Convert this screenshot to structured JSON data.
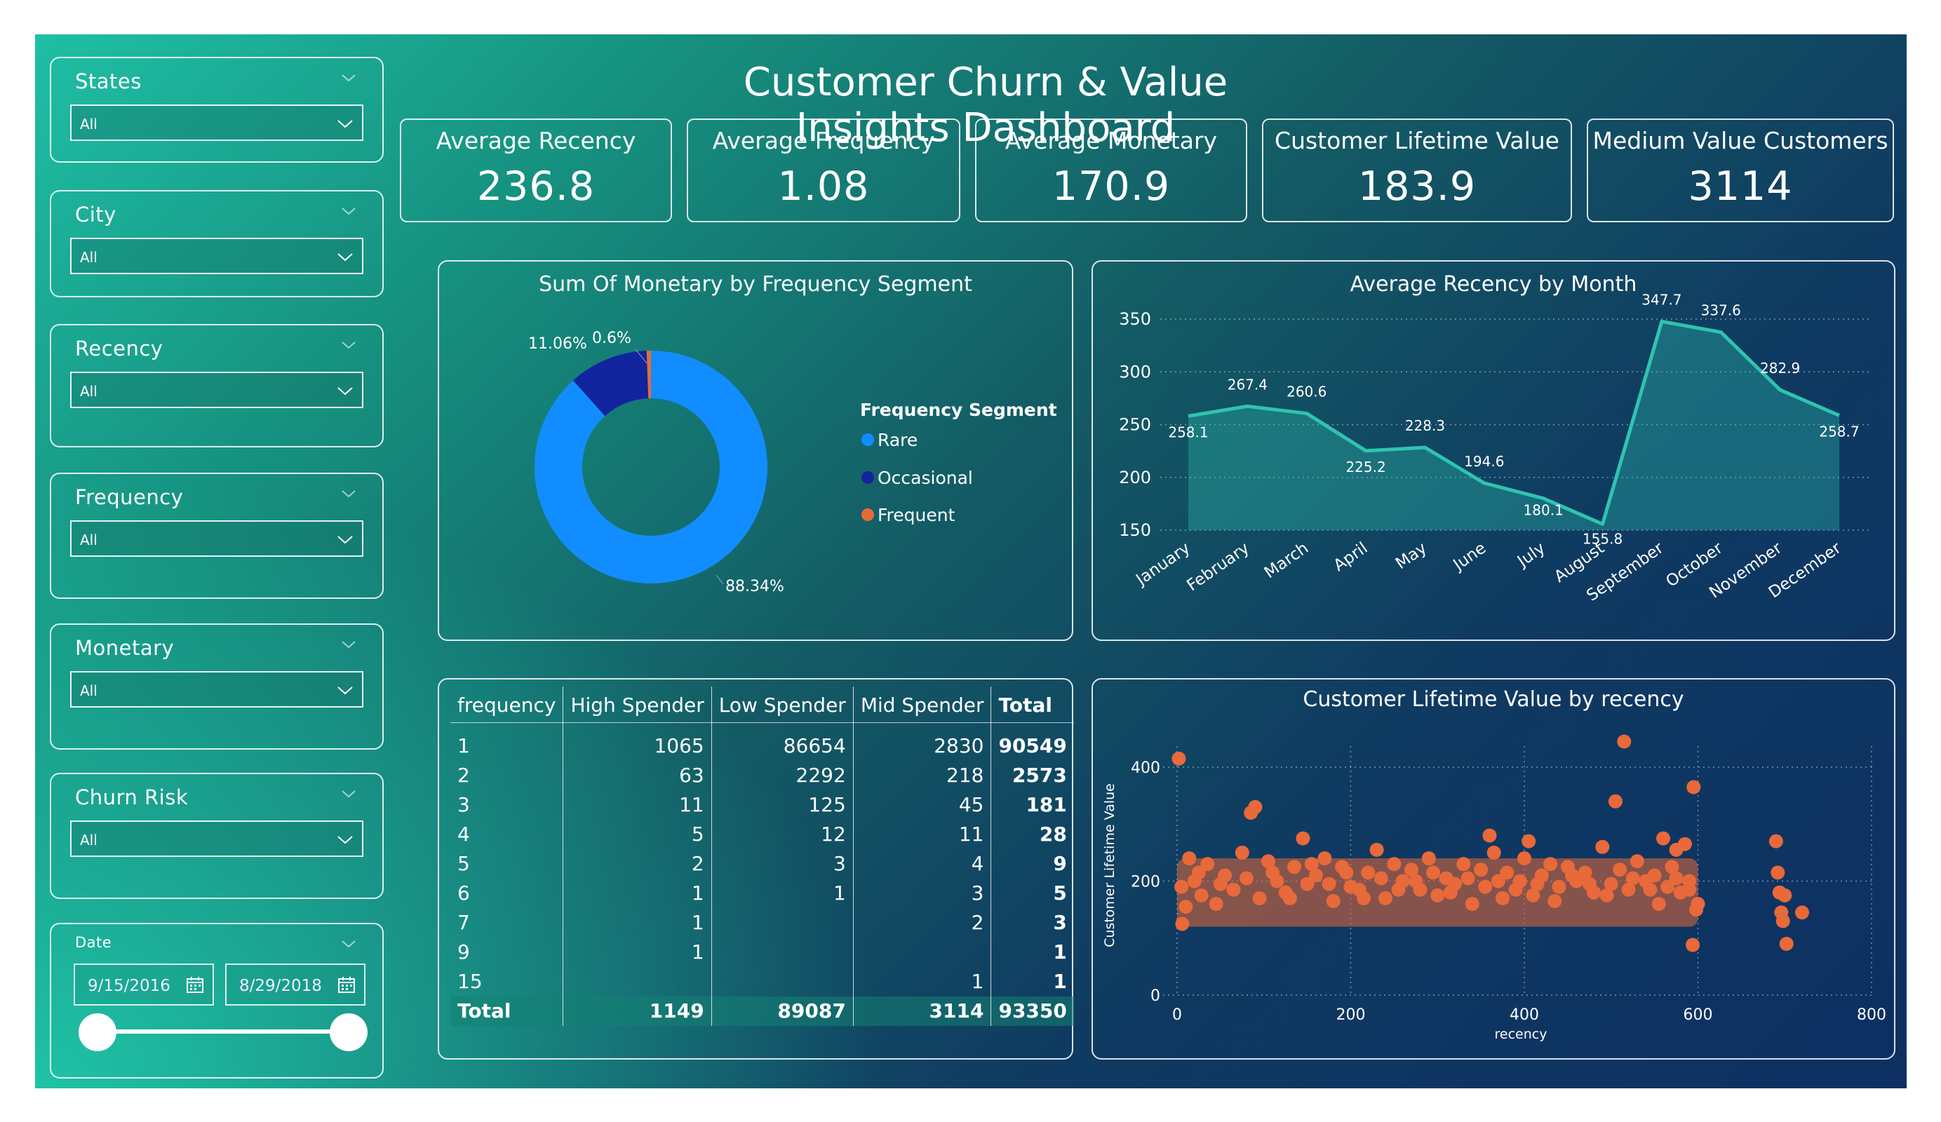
{
  "title": "Customer Churn & Value Insights Dashboard",
  "slicers": [
    {
      "title": "States",
      "value": "All"
    },
    {
      "title": "City",
      "value": "All"
    },
    {
      "title": "Recency",
      "value": "All"
    },
    {
      "title": "Frequency",
      "value": "All"
    },
    {
      "title": "Monetary",
      "value": "All"
    },
    {
      "title": "Churn Risk",
      "value": "All"
    }
  ],
  "date_slicer": {
    "title": "Date",
    "start": "9/15/2016",
    "end": "8/29/2018",
    "range_fraction": [
      0,
      1
    ]
  },
  "kpis": [
    {
      "label": "Average Recency",
      "value": "236.8"
    },
    {
      "label": "Average Frequency",
      "value": "1.08"
    },
    {
      "label": "Average Monetary",
      "value": "170.9"
    },
    {
      "label": "Customer Lifetime Value",
      "value": "183.9"
    },
    {
      "label": "Medium Value Customers",
      "value": "3114"
    }
  ],
  "colors": {
    "rare": "#118dff",
    "occasional": "#12239e",
    "frequent": "#e66c37",
    "line": "#2ec4b0",
    "scatter": "#e8693a"
  },
  "donut_title": "Sum Of Monetary by Frequency Segment",
  "line_title": "Average Recency by Month",
  "scatter_title": "Customer Lifetime Value by recency",
  "table": {
    "headers": [
      "frequency",
      "High Spender",
      "Low Spender",
      "Mid Spender",
      "Total"
    ],
    "rows": [
      [
        "1",
        "1065",
        "86654",
        "2830",
        "90549"
      ],
      [
        "2",
        "63",
        "2292",
        "218",
        "2573"
      ],
      [
        "3",
        "11",
        "125",
        "45",
        "181"
      ],
      [
        "4",
        "5",
        "12",
        "11",
        "28"
      ],
      [
        "5",
        "2",
        "3",
        "4",
        "9"
      ],
      [
        "6",
        "1",
        "1",
        "3",
        "5"
      ],
      [
        "7",
        "1",
        "",
        "2",
        "3"
      ],
      [
        "9",
        "1",
        "",
        "",
        "1"
      ],
      [
        "15",
        "",
        "",
        "1",
        "1"
      ]
    ],
    "total": [
      "Total",
      "1149",
      "89087",
      "3114",
      "93350"
    ]
  },
  "chart_data": [
    {
      "type": "pie",
      "title": "Sum Of Monetary by Frequency Segment",
      "legend_title": "Frequency Segment",
      "legend_position": "right",
      "categories": [
        "Rare",
        "Occasional",
        "Frequent"
      ],
      "values": [
        88.34,
        11.06,
        0.6
      ],
      "labels": [
        "88.34%",
        "11.06%",
        "0.6%"
      ]
    },
    {
      "type": "area",
      "title": "Average Recency by Month",
      "categories": [
        "January",
        "February",
        "March",
        "April",
        "May",
        "June",
        "July",
        "August",
        "September",
        "October",
        "November",
        "December"
      ],
      "values": [
        258.1,
        267.4,
        260.6,
        225.2,
        228.3,
        194.6,
        180.1,
        155.8,
        347.7,
        337.6,
        282.9,
        258.7
      ],
      "yticks": [
        150,
        200,
        250,
        300,
        350
      ],
      "ylim": [
        150,
        350
      ],
      "grid": true
    },
    {
      "type": "scatter",
      "title": "Customer Lifetime Value by recency",
      "xlabel": "recency",
      "ylabel": "Customer Lifetime Value",
      "xlim": [
        0,
        800
      ],
      "ylim": [
        0,
        480
      ],
      "xticks": [
        0,
        200,
        400,
        600,
        800
      ],
      "yticks": [
        0,
        200,
        400
      ],
      "grid": true,
      "points": [
        [
          2,
          415
        ],
        [
          6,
          125
        ],
        [
          10,
          155
        ],
        [
          14,
          240
        ],
        [
          20,
          200
        ],
        [
          28,
          175
        ],
        [
          35,
          230
        ],
        [
          45,
          160
        ],
        [
          55,
          210
        ],
        [
          65,
          185
        ],
        [
          75,
          250
        ],
        [
          85,
          320
        ],
        [
          90,
          330
        ],
        [
          95,
          170
        ],
        [
          105,
          235
        ],
        [
          115,
          200
        ],
        [
          125,
          180
        ],
        [
          135,
          225
        ],
        [
          145,
          275
        ],
        [
          150,
          195
        ],
        [
          160,
          210
        ],
        [
          170,
          240
        ],
        [
          180,
          165
        ],
        [
          190,
          225
        ],
        [
          200,
          190
        ],
        [
          210,
          185
        ],
        [
          220,
          215
        ],
        [
          230,
          255
        ],
        [
          240,
          170
        ],
        [
          250,
          230
        ],
        [
          260,
          200
        ],
        [
          270,
          220
        ],
        [
          280,
          185
        ],
        [
          290,
          240
        ],
        [
          300,
          175
        ],
        [
          310,
          205
        ],
        [
          320,
          195
        ],
        [
          330,
          230
        ],
        [
          340,
          160
        ],
        [
          350,
          220
        ],
        [
          360,
          280
        ],
        [
          365,
          250
        ],
        [
          370,
          200
        ],
        [
          380,
          215
        ],
        [
          390,
          185
        ],
        [
          400,
          240
        ],
        [
          405,
          270
        ],
        [
          410,
          175
        ],
        [
          420,
          210
        ],
        [
          430,
          230
        ],
        [
          440,
          190
        ],
        [
          450,
          225
        ],
        [
          460,
          200
        ],
        [
          470,
          215
        ],
        [
          480,
          180
        ],
        [
          490,
          260
        ],
        [
          500,
          195
        ],
        [
          505,
          340
        ],
        [
          510,
          220
        ],
        [
          515,
          445
        ],
        [
          520,
          185
        ],
        [
          530,
          235
        ],
        [
          540,
          200
        ],
        [
          550,
          210
        ],
        [
          560,
          275
        ],
        [
          565,
          190
        ],
        [
          570,
          225
        ],
        [
          575,
          255
        ],
        [
          580,
          180
        ],
        [
          585,
          265
        ],
        [
          590,
          200
        ],
        [
          595,
          365
        ],
        [
          598,
          150
        ],
        [
          600,
          160
        ],
        [
          5,
          190
        ],
        [
          25,
          215
        ],
        [
          50,
          195
        ],
        [
          80,
          205
        ],
        [
          110,
          215
        ],
        [
          130,
          170
        ],
        [
          155,
          230
        ],
        [
          175,
          195
        ],
        [
          195,
          215
        ],
        [
          215,
          170
        ],
        [
          235,
          205
        ],
        [
          255,
          185
        ],
        [
          275,
          200
        ],
        [
          295,
          215
        ],
        [
          315,
          180
        ],
        [
          335,
          205
        ],
        [
          355,
          190
        ],
        [
          375,
          170
        ],
        [
          395,
          200
        ],
        [
          415,
          195
        ],
        [
          435,
          165
        ],
        [
          455,
          210
        ],
        [
          475,
          195
        ],
        [
          495,
          175
        ],
        [
          525,
          205
        ],
        [
          545,
          185
        ],
        [
          555,
          160
        ],
        [
          575,
          205
        ],
        [
          590,
          185
        ],
        [
          594,
          88
        ],
        [
          690,
          270
        ],
        [
          692,
          215
        ],
        [
          694,
          180
        ],
        [
          696,
          145
        ],
        [
          698,
          130
        ],
        [
          700,
          175
        ],
        [
          702,
          90
        ],
        [
          720,
          145
        ]
      ]
    }
  ]
}
